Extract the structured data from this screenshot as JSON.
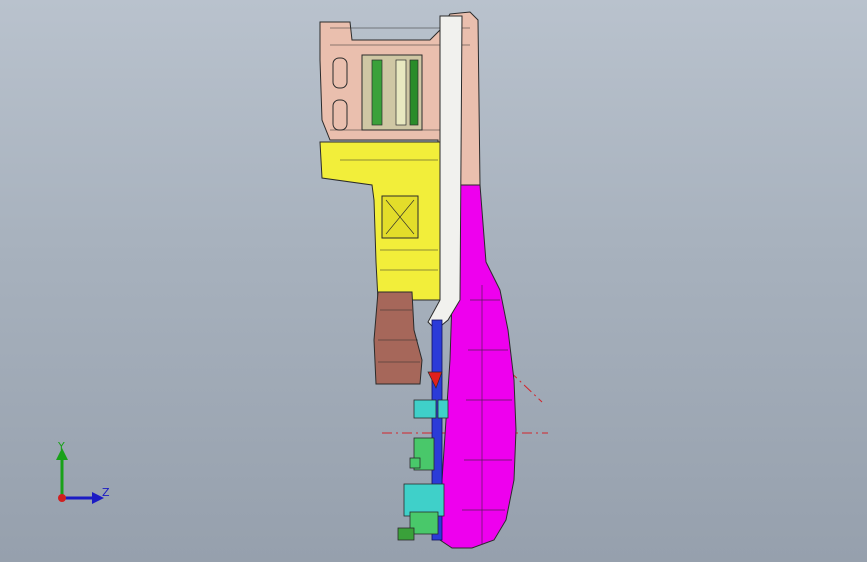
{
  "view": {
    "background": "gradient-grey-blue",
    "triad": {
      "y_label": "Y",
      "z_label": "Z",
      "x_color": "#d11f1f",
      "y_color": "#19a119",
      "z_color": "#1b1bc4"
    }
  },
  "colors": {
    "outline": "#2b2b2b",
    "upper_body": "#eabfae",
    "yellow_panel": "#f2ee3a",
    "brown_bracket": "#a6675a",
    "white_tube": "#f1f1ee",
    "magenta_cover": "#ee00ee",
    "blue_pipe": "#2b3bd8",
    "cyan_part": "#3fd0c9",
    "green_part": "#49c86a",
    "red_marker": "#e0201c",
    "centerline": "#d2242b"
  }
}
